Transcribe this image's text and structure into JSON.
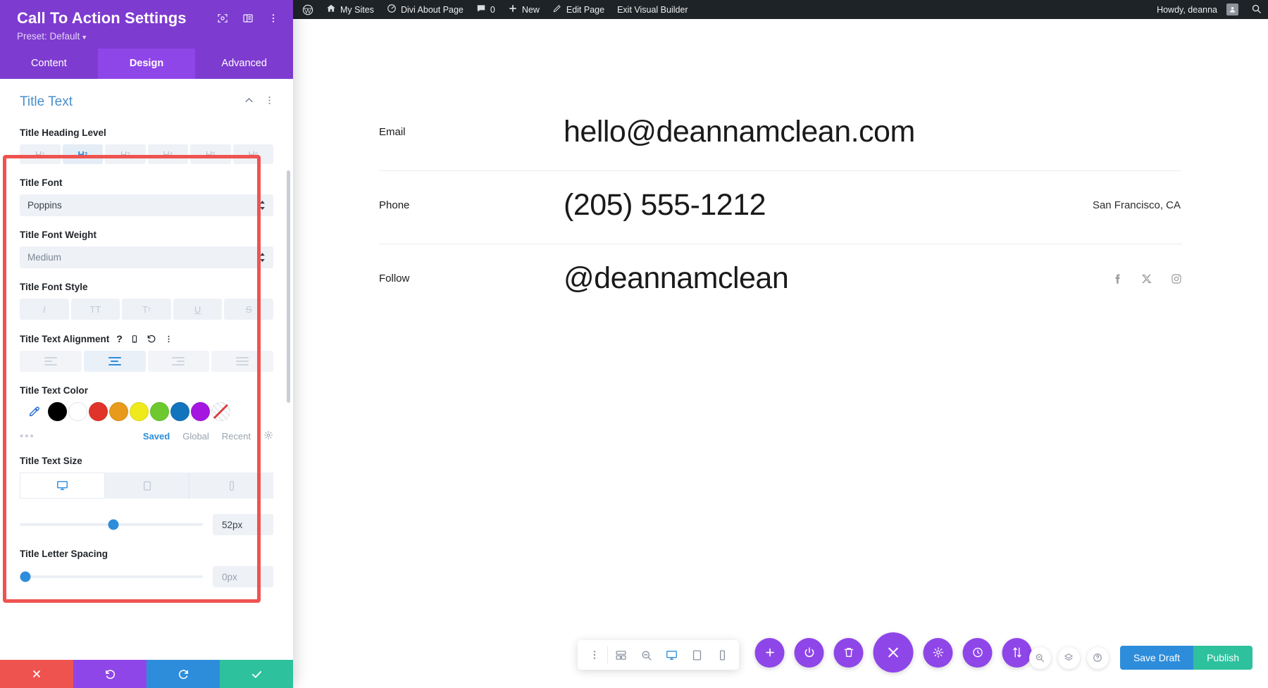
{
  "settings_panel": {
    "title": "Call To Action Settings",
    "preset_label": "Preset: Default",
    "header_icons": [
      "target-icon",
      "layout-icon",
      "more-vertical-icon"
    ],
    "tabs": [
      {
        "label": "Content",
        "active": false
      },
      {
        "label": "Design",
        "active": true
      },
      {
        "label": "Advanced",
        "active": false
      }
    ],
    "section": {
      "title": "Title Text",
      "collapse_icon": "chevron-up-icon",
      "more_icon": "more-vertical-icon"
    },
    "fields": {
      "heading_level": {
        "label": "Title Heading Level",
        "options": [
          "H1",
          "H2",
          "H3",
          "H4",
          "H5",
          "H6"
        ],
        "selected": "H2"
      },
      "title_font": {
        "label": "Title Font",
        "value": "Poppins"
      },
      "title_font_weight": {
        "label": "Title Font Weight",
        "value": "Medium"
      },
      "title_font_style": {
        "label": "Title Font Style",
        "options": [
          "I",
          "TT",
          "Tт",
          "U",
          "S"
        ]
      },
      "title_text_alignment": {
        "label": "Title Text Alignment",
        "icons": [
          "help-icon",
          "mobile-icon",
          "reset-icon",
          "more-vertical-icon"
        ],
        "options": [
          "align-left",
          "align-center",
          "align-right",
          "align-justify"
        ],
        "selected": "align-center"
      },
      "title_text_color": {
        "label": "Title Text Color",
        "eyedropper": "eyedropper-icon",
        "swatches": [
          "#000000",
          "#ffffff",
          "#e0342a",
          "#e89a1c",
          "#eeea1c",
          "#6dc92e",
          "#1274bd",
          "#a516e0",
          "none"
        ],
        "dots": "•••",
        "tabs": [
          {
            "label": "Saved",
            "active": true
          },
          {
            "label": "Global",
            "active": false
          },
          {
            "label": "Recent",
            "active": false
          }
        ],
        "gear_icon": "gear-icon"
      },
      "title_text_size": {
        "label": "Title Text Size",
        "devices": [
          {
            "name": "desktop-icon",
            "active": true
          },
          {
            "name": "tablet-icon",
            "active": false
          },
          {
            "name": "phone-icon",
            "active": false
          }
        ],
        "value": "52px",
        "slider_percent": 51
      },
      "title_letter_spacing": {
        "label": "Title Letter Spacing",
        "value": "0px",
        "slider_percent": 3
      }
    },
    "footer": [
      {
        "name": "cancel-button",
        "icon": "close-icon"
      },
      {
        "name": "undo-button",
        "icon": "undo-icon"
      },
      {
        "name": "redo-button",
        "icon": "redo-icon"
      },
      {
        "name": "save-button",
        "icon": "check-icon"
      }
    ]
  },
  "admin_bar": {
    "wp_logo": "wordpress-icon",
    "items": [
      {
        "label": "My Sites",
        "icon": "sites-icon"
      },
      {
        "label": "Divi About Page",
        "icon": "dashboard-icon"
      },
      {
        "label": "0",
        "icon": "comment-icon"
      },
      {
        "label": "New",
        "icon": "plus-icon"
      },
      {
        "label": "Edit Page",
        "icon": "pencil-icon"
      },
      {
        "label": "Exit Visual Builder",
        "icon": ""
      }
    ],
    "howdy": "Howdy, deanna",
    "avatar": "avatar-icon",
    "search": "search-icon"
  },
  "page": {
    "rows": [
      {
        "label": "Email",
        "value": "hello@deannamclean.com",
        "extra": "",
        "socials": []
      },
      {
        "label": "Phone",
        "value": "(205) 555-1212",
        "extra": "San Francisco, CA",
        "socials": []
      },
      {
        "label": "Follow",
        "value": "@deannamclean",
        "extra": "",
        "socials": [
          "facebook-icon",
          "x-twitter-icon",
          "instagram-icon"
        ]
      }
    ]
  },
  "mini_toolbar": {
    "buttons": [
      {
        "name": "drag-handle-icon",
        "active": false
      },
      {
        "name": "wireframe-icon",
        "active": false
      },
      {
        "name": "zoom-out-icon",
        "active": false
      },
      {
        "name": "desktop-view-icon",
        "active": true
      },
      {
        "name": "tablet-view-icon",
        "active": false
      },
      {
        "name": "phone-view-icon",
        "active": false
      }
    ]
  },
  "float_toolbar": {
    "buttons": [
      {
        "name": "add-icon",
        "big": false
      },
      {
        "name": "power-icon",
        "big": false
      },
      {
        "name": "trash-icon",
        "big": false
      },
      {
        "name": "close-icon",
        "big": true
      },
      {
        "name": "settings-gear-icon",
        "big": false
      },
      {
        "name": "history-clock-icon",
        "big": false
      },
      {
        "name": "sort-arrows-icon",
        "big": false
      }
    ]
  },
  "bottom_right": {
    "icons": [
      "search-zoom-icon",
      "layers-icon",
      "help-circle-icon"
    ],
    "save_draft_label": "Save Draft",
    "publish_label": "Publish"
  },
  "colors": {
    "purple": "#7e3bd0",
    "purple_active": "#8f46e8",
    "blue": "#2d8ddb",
    "green": "#2ec19e",
    "red": "#ef5350",
    "admin_dark": "#1d2327"
  }
}
